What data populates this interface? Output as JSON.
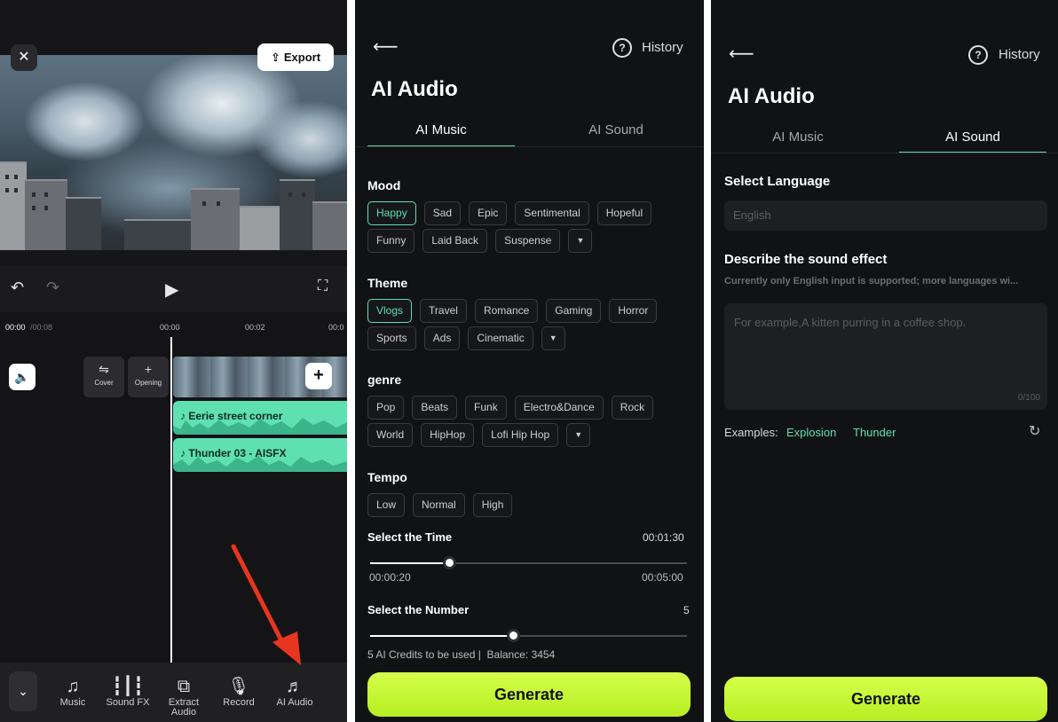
{
  "editor": {
    "export_label": "Export",
    "close_icon": "close-icon",
    "timecode_current": "00:00",
    "timecode_total": "/00:08",
    "ruler_marks": [
      "00:00",
      "00:02",
      "00:0"
    ],
    "tiles": {
      "cover_label": "Cover",
      "opening_label": "Opening"
    },
    "audio_clips": [
      {
        "label": "Eerie street corner"
      },
      {
        "label": "Thunder 03 - AISFX"
      }
    ],
    "accent_color": "#5fe0b2",
    "arrow_color": "#e8351f",
    "toolbar": [
      {
        "label": "Music",
        "icon": "music-note-icon"
      },
      {
        "label": "Sound FX",
        "icon": "sound-bars-icon"
      },
      {
        "label": "Extract Audio",
        "icon": "extract-audio-icon"
      },
      {
        "label": "Record",
        "icon": "microphone-icon"
      },
      {
        "label": "AI Audio",
        "icon": "ai-audio-icon"
      }
    ]
  },
  "ai_music": {
    "history_label": "History",
    "title": "AI Audio",
    "tabs": [
      "AI Music",
      "AI Sound"
    ],
    "active_tab": "AI Music",
    "mood": {
      "label": "Mood",
      "row1": [
        "Happy",
        "Sad",
        "Epic",
        "Sentimental",
        "Hopeful"
      ],
      "row2": [
        "Funny",
        "Laid Back",
        "Suspense"
      ],
      "selected": "Happy"
    },
    "theme": {
      "label": "Theme",
      "row1": [
        "Vlogs",
        "Travel",
        "Romance",
        "Gaming",
        "Horror"
      ],
      "row2": [
        "Sports",
        "Ads",
        "Cinematic"
      ],
      "selected": "Vlogs"
    },
    "genre": {
      "label": "genre",
      "row1": [
        "Pop",
        "Beats",
        "Funk",
        "Electro&Dance",
        "Rock"
      ],
      "row2": [
        "World",
        "HipHop",
        "Lofi Hip Hop"
      ]
    },
    "tempo": {
      "label": "Tempo",
      "options": [
        "Low",
        "Normal",
        "High"
      ]
    },
    "time": {
      "label": "Select the Time",
      "value": "00:01:30",
      "min": "00:00:20",
      "max": "00:05:00",
      "fraction": 0.25
    },
    "number": {
      "label": "Select the Number",
      "value": "5",
      "fraction": 0.45
    },
    "credits_text": "5 AI Credits to be used",
    "balance_text": "Balance: 3454",
    "generate_label": "Generate",
    "generate_color": "#c8f535"
  },
  "ai_sound": {
    "history_label": "History",
    "title": "AI Audio",
    "tabs": [
      "AI Music",
      "AI Sound"
    ],
    "active_tab": "AI Sound",
    "language_label": "Select Language",
    "language_placeholder": "English",
    "describe_label": "Describe the sound effect",
    "describe_hint": "Currently only English input is supported; more languages wi...",
    "textarea_placeholder": "For example,A kitten purring in a coffee shop.",
    "char_count": "0/100",
    "examples_label": "Examples:",
    "examples": [
      "Explosion",
      "Thunder"
    ],
    "generate_label": "Generate"
  }
}
